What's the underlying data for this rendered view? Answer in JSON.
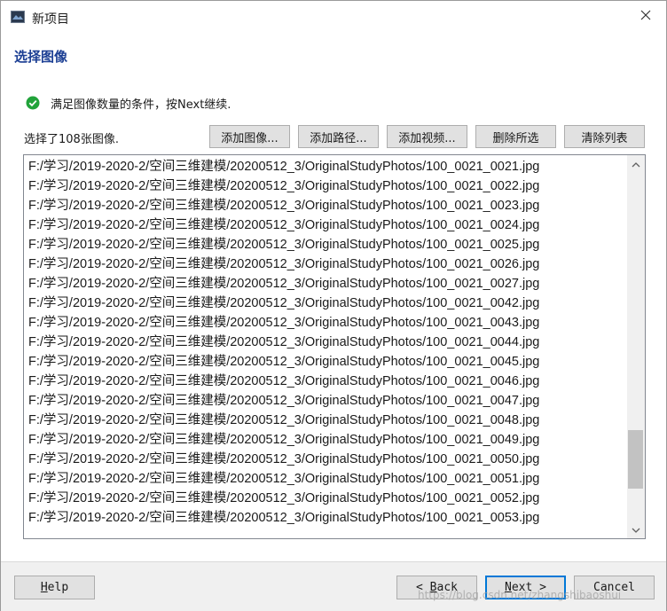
{
  "window": {
    "title": "新项目",
    "close_icon": "close-icon",
    "app_icon": "app-window-icon"
  },
  "page": {
    "title": "选择图像"
  },
  "status": {
    "icon": "check-circle-icon",
    "icon_color": "#21a33a",
    "text": "满足图像数量的条件，按Next继续."
  },
  "image_count_label": "选择了108张图像.",
  "toolbar": {
    "add_images": "添加图像...",
    "add_path": "添加路径...",
    "add_video": "添加视频...",
    "delete_selected": "删除所选",
    "clear_list": "清除列表"
  },
  "file_list": [
    "F:/学习/2019-2020-2/空间三维建模/20200512_3/OriginalStudyPhotos/100_0021_0021.jpg",
    "F:/学习/2019-2020-2/空间三维建模/20200512_3/OriginalStudyPhotos/100_0021_0022.jpg",
    "F:/学习/2019-2020-2/空间三维建模/20200512_3/OriginalStudyPhotos/100_0021_0023.jpg",
    "F:/学习/2019-2020-2/空间三维建模/20200512_3/OriginalStudyPhotos/100_0021_0024.jpg",
    "F:/学习/2019-2020-2/空间三维建模/20200512_3/OriginalStudyPhotos/100_0021_0025.jpg",
    "F:/学习/2019-2020-2/空间三维建模/20200512_3/OriginalStudyPhotos/100_0021_0026.jpg",
    "F:/学习/2019-2020-2/空间三维建模/20200512_3/OriginalStudyPhotos/100_0021_0027.jpg",
    "F:/学习/2019-2020-2/空间三维建模/20200512_3/OriginalStudyPhotos/100_0021_0042.jpg",
    "F:/学习/2019-2020-2/空间三维建模/20200512_3/OriginalStudyPhotos/100_0021_0043.jpg",
    "F:/学习/2019-2020-2/空间三维建模/20200512_3/OriginalStudyPhotos/100_0021_0044.jpg",
    "F:/学习/2019-2020-2/空间三维建模/20200512_3/OriginalStudyPhotos/100_0021_0045.jpg",
    "F:/学习/2019-2020-2/空间三维建模/20200512_3/OriginalStudyPhotos/100_0021_0046.jpg",
    "F:/学习/2019-2020-2/空间三维建模/20200512_3/OriginalStudyPhotos/100_0021_0047.jpg",
    "F:/学习/2019-2020-2/空间三维建模/20200512_3/OriginalStudyPhotos/100_0021_0048.jpg",
    "F:/学习/2019-2020-2/空间三维建模/20200512_3/OriginalStudyPhotos/100_0021_0049.jpg",
    "F:/学习/2019-2020-2/空间三维建模/20200512_3/OriginalStudyPhotos/100_0021_0050.jpg",
    "F:/学习/2019-2020-2/空间三维建模/20200512_3/OriginalStudyPhotos/100_0021_0051.jpg",
    "F:/学习/2019-2020-2/空间三维建模/20200512_3/OriginalStudyPhotos/100_0021_0052.jpg",
    "F:/学习/2019-2020-2/空间三维建模/20200512_3/OriginalStudyPhotos/100_0021_0053.jpg"
  ],
  "scroll_position": 0.89,
  "footer": {
    "help": {
      "mnemonic": "H",
      "rest": "elp"
    },
    "back": {
      "prefix": "< ",
      "mnemonic": "B",
      "rest": "ack"
    },
    "next": {
      "mnemonic": "N",
      "rest": "ext",
      "suffix": " >"
    },
    "cancel": "Cancel"
  },
  "watermark": "https://blog.csdn.net/zhangshibaoshui"
}
